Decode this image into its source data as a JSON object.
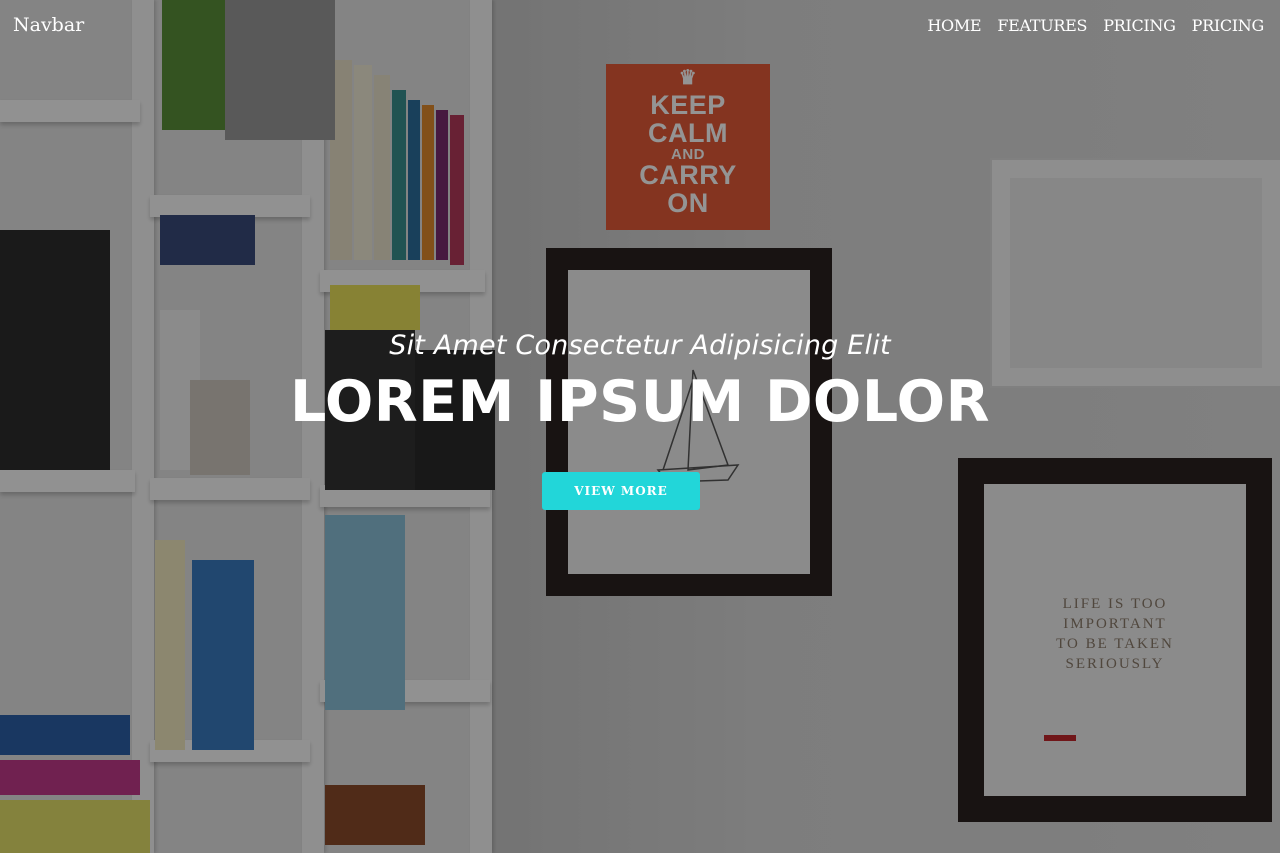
{
  "navbar": {
    "brand": "Navbar",
    "links": [
      "HOME",
      "FEATURES",
      "PRICING",
      "PRICING"
    ]
  },
  "hero": {
    "subtitle": "Sit Amet Consectetur Adipisicing Elit",
    "headline": "LOREM IPSUM DOLOR",
    "cta_label": "VIEW MORE"
  },
  "background": {
    "poster_lines": [
      "KEEP",
      "CALM",
      "AND",
      "CARRY",
      "ON"
    ],
    "art_text_lines": [
      "LIFE IS TOO",
      "IMPORTANT",
      "TO BE TAKEN",
      "SERIOUSLY"
    ]
  },
  "colors": {
    "accent": "#22d6d9",
    "overlay": "rgba(0,0,0,0.42)",
    "text": "#ffffff"
  }
}
